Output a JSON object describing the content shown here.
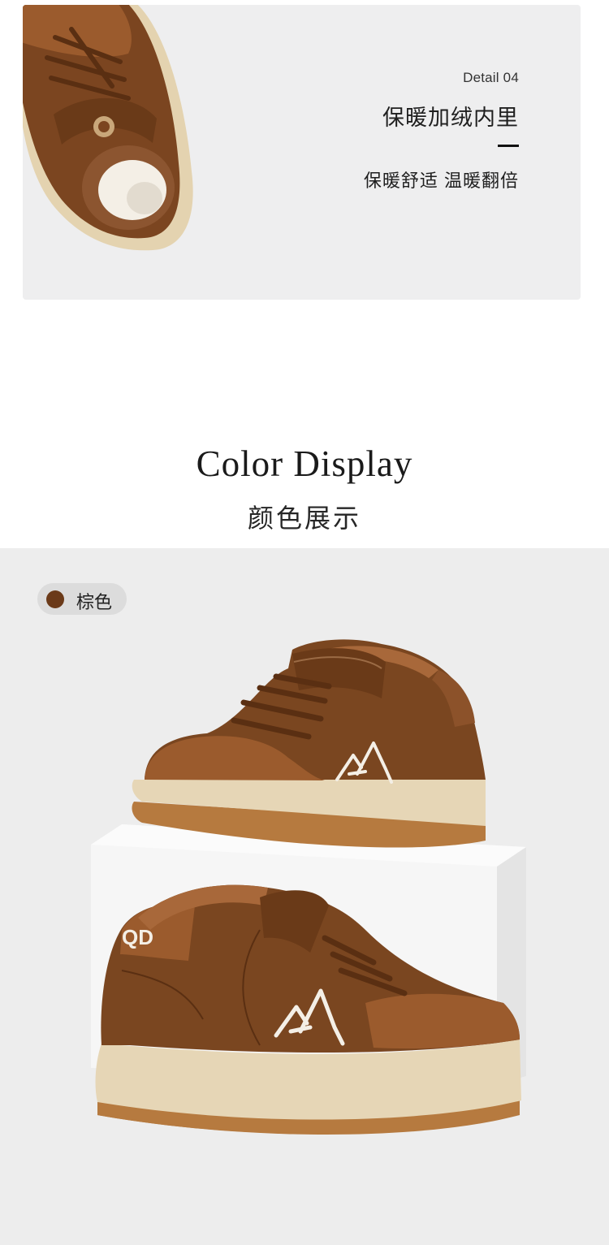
{
  "detail": {
    "number": "Detail 04",
    "title": "保暖加绒内里",
    "subtitle": "保暖舒适 温暖翻倍",
    "image_icon": "shoe-top-view-illustration"
  },
  "color_display": {
    "title_en": "Color Display",
    "title_cn": "颜色展示"
  },
  "colors": [
    {
      "label": "棕色",
      "swatch": "#6b3a19"
    }
  ],
  "heel_tab_text": "QD",
  "palette": {
    "panel_bg": "#eeeeef",
    "section_bg": "#ededed",
    "leather": "#7a4620",
    "suede": "#9a5a2c",
    "sole": "#e6d6b6",
    "gum": "#b97a3e",
    "pedestal": "#f7f7f7"
  }
}
